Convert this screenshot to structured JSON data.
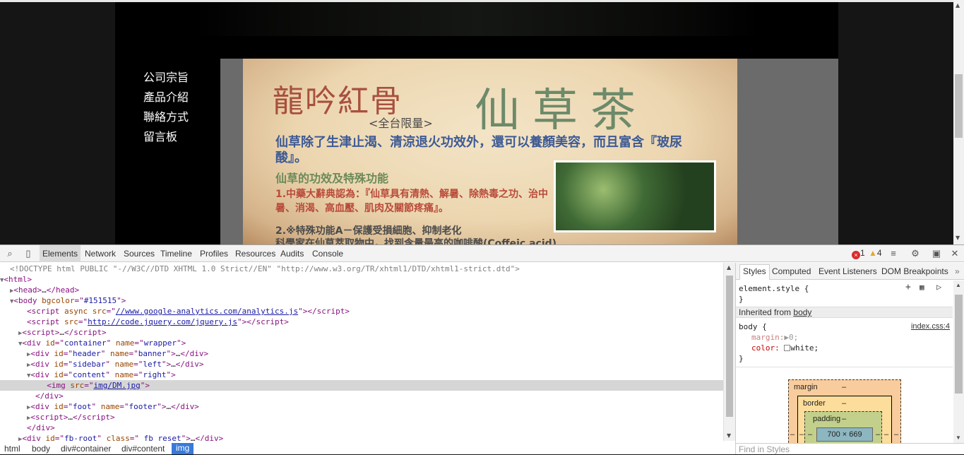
{
  "page": {
    "nav": [
      "公司宗旨",
      "產品介紹",
      "聯絡方式",
      "留言板"
    ],
    "ad": {
      "title_left": "龍吟紅骨",
      "title_right": "仙草茶",
      "subtitle": "<全台限量>",
      "intro": "仙草除了生津止渴、清涼退火功效外，還可以養顏美容，而且富含『玻尿酸』。",
      "heading": "仙草的功效及特殊功能",
      "point1": "1.中藥大辭典認為：『仙草具有清熱、解暑、除熱毒之功、治中暑、消渴、高血壓、肌肉及關節疼痛』。",
      "point2": "2.※特殊功能A－保護受損細胞、抑制老化",
      "point2b": "科學家在仙草萃取物中，找到含量最高的咖啡酸(Coffeic acid)"
    }
  },
  "devtools": {
    "tabs": [
      "Elements",
      "Network",
      "Sources",
      "Timeline",
      "Profiles",
      "Resources",
      "Audits",
      "Console"
    ],
    "active_tab": "Elements",
    "errors": "1",
    "warnings": "4",
    "dom": {
      "doctype": "<!DOCTYPE html PUBLIC \"-//W3C//DTD XHTML 1.0 Strict//EN\" \"http://www.w3.org/TR/xhtml1/DTD/xhtml1-strict.dtd\">",
      "ga_src": "//www.google-analytics.com/analytics.js",
      "jq_src": "http://code.jquery.com/jquery.js",
      "img_src": "img/DM.jpg",
      "body_bgcolor": "#151515"
    },
    "breadcrumbs": [
      "html",
      "body",
      "div#container",
      "div#content",
      "img"
    ],
    "side_tabs": [
      "Styles",
      "Computed",
      "Event Listeners",
      "DOM Breakpoints"
    ],
    "styles": {
      "element_style": "element.style {",
      "close": "}",
      "inherited": "Inherited from",
      "inherited_link": "body",
      "rule_selector": "body {",
      "rule_source": "index.css:4",
      "margin_prop": "margin:",
      "margin_val": "0;",
      "color_prop": "color:",
      "color_val": "white;"
    },
    "boxmodel": {
      "margin": "margin",
      "border": "border",
      "padding": "padding",
      "dash": "–",
      "content": "700 × 669"
    },
    "find_placeholder": "Find in Styles"
  }
}
